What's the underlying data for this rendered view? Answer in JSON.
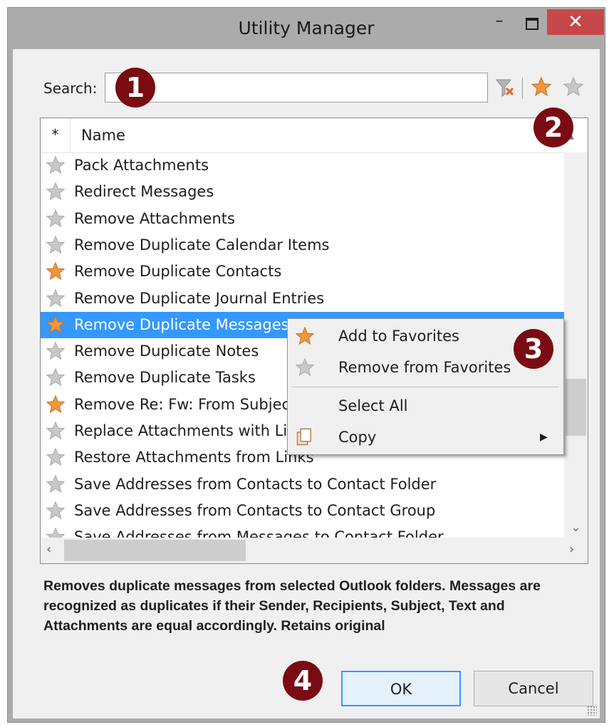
{
  "window": {
    "title": "Utility Manager",
    "min_glyph": "–",
    "close_glyph": "✕"
  },
  "search": {
    "label": "Search:",
    "value": "",
    "placeholder": ""
  },
  "list": {
    "header_star": "*",
    "header_name": "Name",
    "items": [
      {
        "label": "Pack Attachments",
        "favorite": false
      },
      {
        "label": "Redirect Messages",
        "favorite": false
      },
      {
        "label": "Remove Attachments",
        "favorite": false
      },
      {
        "label": "Remove Duplicate Calendar Items",
        "favorite": false
      },
      {
        "label": "Remove Duplicate Contacts",
        "favorite": true
      },
      {
        "label": "Remove Duplicate Journal Entries",
        "favorite": false
      },
      {
        "label": "Remove Duplicate Messages",
        "favorite": true,
        "selected": true
      },
      {
        "label": "Remove Duplicate Notes",
        "favorite": false
      },
      {
        "label": "Remove Duplicate Tasks",
        "favorite": false
      },
      {
        "label": "Remove Re: Fw: From Subject",
        "favorite": true
      },
      {
        "label": "Replace Attachments with Links",
        "favorite": false
      },
      {
        "label": "Restore Attachments from Links",
        "favorite": false
      },
      {
        "label": "Save Addresses from Contacts to Contact Folder",
        "favorite": false
      },
      {
        "label": "Save Addresses from Contacts to Contact Group",
        "favorite": false
      },
      {
        "label": "Save Addresses from Messages to Contact Folder",
        "favorite": false
      }
    ]
  },
  "context_menu": {
    "add_favorites": "Add to Favorites",
    "remove_favorites": "Remove from Favorites",
    "select_all": "Select All",
    "copy": "Copy"
  },
  "description": "Removes duplicate messages from selected Outlook folders. Messages are recognized as duplicates if their Sender, Recipients, Subject, Text and Attachments are equal accordingly. Retains original",
  "buttons": {
    "ok": "OK",
    "cancel": "Cancel"
  },
  "callouts": [
    "1",
    "2",
    "3",
    "4"
  ],
  "colors": {
    "star_favorite": "#f0963c",
    "star_normal": "#c8c8c8",
    "selection": "#3399ff",
    "close_button": "#c7484a",
    "callout": "#7a0b12"
  }
}
